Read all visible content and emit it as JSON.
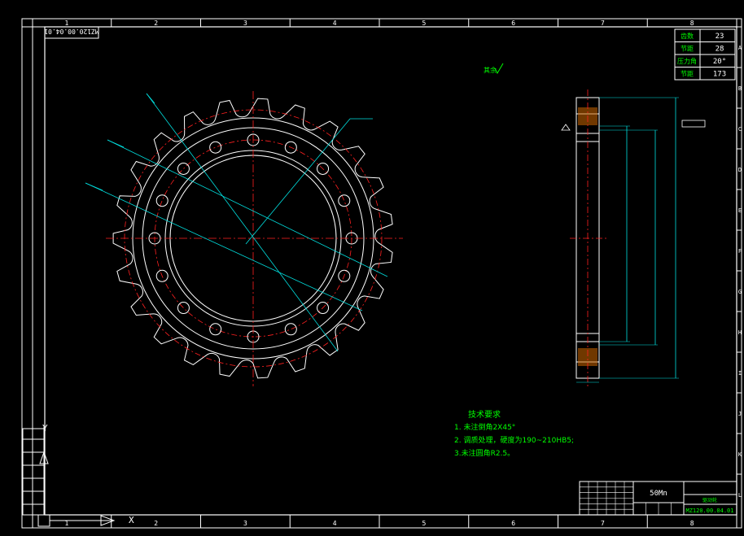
{
  "drawing": {
    "code_stamp": "MZ120.00.04.01",
    "roughness_label": "其余",
    "col_numbers": [
      "1",
      "2",
      "3",
      "4",
      "5",
      "6",
      "7",
      "8"
    ],
    "row_letters": [
      "A",
      "B",
      "C",
      "D",
      "E",
      "F",
      "G",
      "H",
      "I",
      "J",
      "K",
      "L"
    ],
    "param_table": [
      {
        "label": "齿数",
        "value": "23"
      },
      {
        "label": "节距",
        "value": "28"
      },
      {
        "label": "压力角",
        "value": "20°"
      },
      {
        "label": "节距",
        "value": "173"
      }
    ],
    "tech_requirements": {
      "title": "技术要求",
      "items": [
        "1. 未注倒角2X45°",
        "2. 调质处理，硬度为190~210HB5;",
        "3.未注圆角R2.5。"
      ]
    },
    "title_block": {
      "material": "50Mn",
      "part_name": "驱动轮",
      "drawing_no": "MZ120.00.04.01"
    },
    "colors": {
      "frame": "#ffffff",
      "drawing": "#ffffff",
      "center_lines": "#ff2020",
      "dimensions": "#00e0e0",
      "text": "#00ff00",
      "section_fill": "#cc6600"
    }
  }
}
